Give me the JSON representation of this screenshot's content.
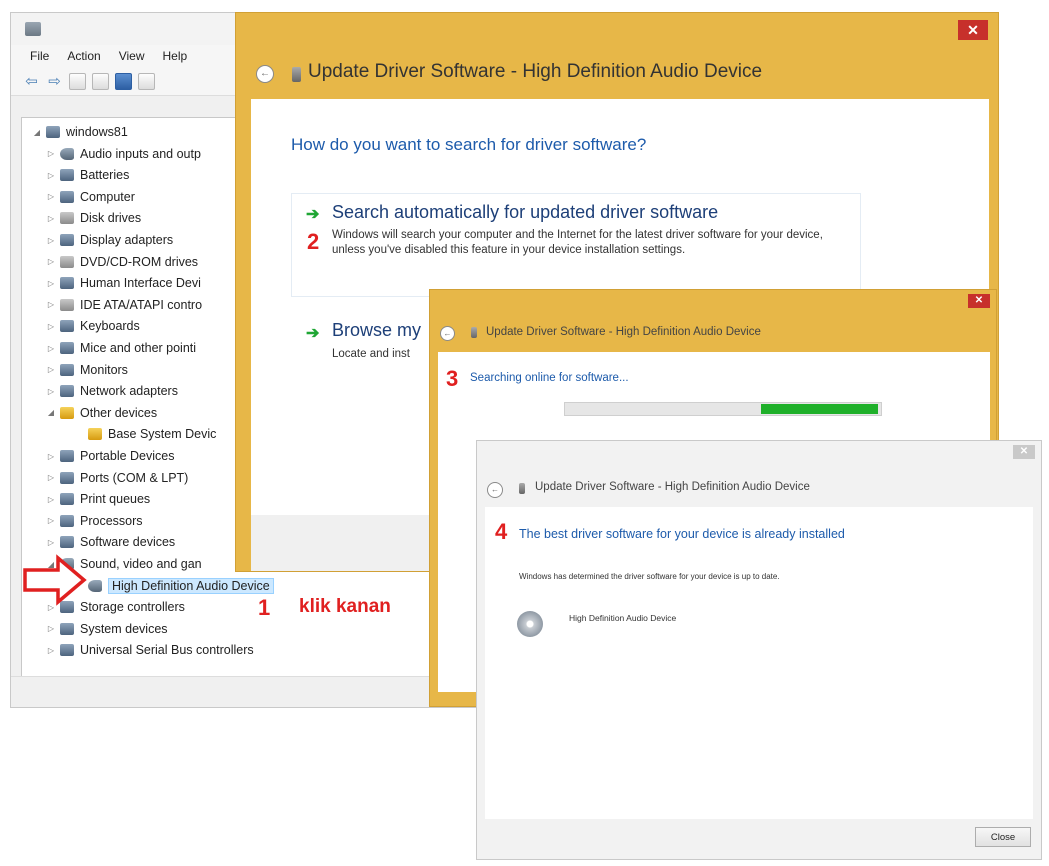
{
  "device_manager": {
    "menu": [
      "File",
      "Action",
      "View",
      "Help"
    ],
    "tree": [
      {
        "label": "windows81",
        "expander": "◢",
        "icon": "computer"
      },
      {
        "label": "Audio inputs and outp",
        "expander": "▷",
        "icon": "audio"
      },
      {
        "label": "Batteries",
        "expander": "▷",
        "icon": "battery"
      },
      {
        "label": "Computer",
        "expander": "▷",
        "icon": "computer"
      },
      {
        "label": "Disk drives",
        "expander": "▷",
        "icon": "disk"
      },
      {
        "label": "Display adapters",
        "expander": "▷",
        "icon": "display"
      },
      {
        "label": "DVD/CD-ROM drives",
        "expander": "▷",
        "icon": "disk"
      },
      {
        "label": "Human Interface Devi",
        "expander": "▷",
        "icon": "hid"
      },
      {
        "label": "IDE ATA/ATAPI contro",
        "expander": "▷",
        "icon": "disk"
      },
      {
        "label": "Keyboards",
        "expander": "▷",
        "icon": "keyboard"
      },
      {
        "label": "Mice and other pointi",
        "expander": "▷",
        "icon": "mouse"
      },
      {
        "label": "Monitors",
        "expander": "▷",
        "icon": "display"
      },
      {
        "label": "Network adapters",
        "expander": "▷",
        "icon": "network"
      },
      {
        "label": "Other devices",
        "expander": "◢",
        "icon": "warn"
      },
      {
        "label": "Base System Devic",
        "expander": "",
        "icon": "warn"
      },
      {
        "label": "Portable Devices",
        "expander": "▷",
        "icon": "portable"
      },
      {
        "label": "Ports (COM & LPT)",
        "expander": "▷",
        "icon": "port"
      },
      {
        "label": "Print queues",
        "expander": "▷",
        "icon": "printer"
      },
      {
        "label": "Processors",
        "expander": "▷",
        "icon": "cpu"
      },
      {
        "label": "Software devices",
        "expander": "▷",
        "icon": "software"
      },
      {
        "label": "Sound, video and gan",
        "expander": "◢",
        "icon": "audio"
      },
      {
        "label": "High Definition Audio Device",
        "expander": "",
        "icon": "audio"
      },
      {
        "label": "Storage controllers",
        "expander": "▷",
        "icon": "storage"
      },
      {
        "label": "System devices",
        "expander": "▷",
        "icon": "system"
      },
      {
        "label": "Universal Serial Bus controllers",
        "expander": "▷",
        "icon": "usb"
      }
    ]
  },
  "annotations": {
    "step1": "1",
    "step1_text": "klik kanan",
    "step2": "2",
    "step3": "3",
    "step4": "4"
  },
  "dialog1": {
    "close": "✕",
    "title": "Update Driver Software - High Definition Audio Device",
    "heading": "How do you want to search for driver software?",
    "option1_title": "Search automatically for updated driver software",
    "option1_desc": "Windows will search your computer and the Internet for the latest driver software for your device, unless you've disabled this feature in your device installation settings.",
    "option2_title": "Browse my",
    "option2_desc": "Locate and inst"
  },
  "dialog2": {
    "close": "✕",
    "title": "Update Driver Software - High Definition Audio Device",
    "status": "Searching online for software...",
    "progress_start": 0.62,
    "progress_end": 0.99
  },
  "dialog3": {
    "close": "✕",
    "title": "Update Driver Software - High Definition Audio Device",
    "heading": "The best driver software for your device is already installed",
    "description": "Windows has determined the driver software for your device is up to date.",
    "device": "High Definition Audio Device",
    "close_button": "Close"
  },
  "colors": {
    "dialog_frame": "#e7b748",
    "link_blue": "#1d5bab",
    "annotation_red": "#e02020",
    "progress_green": "#1fb02a"
  }
}
